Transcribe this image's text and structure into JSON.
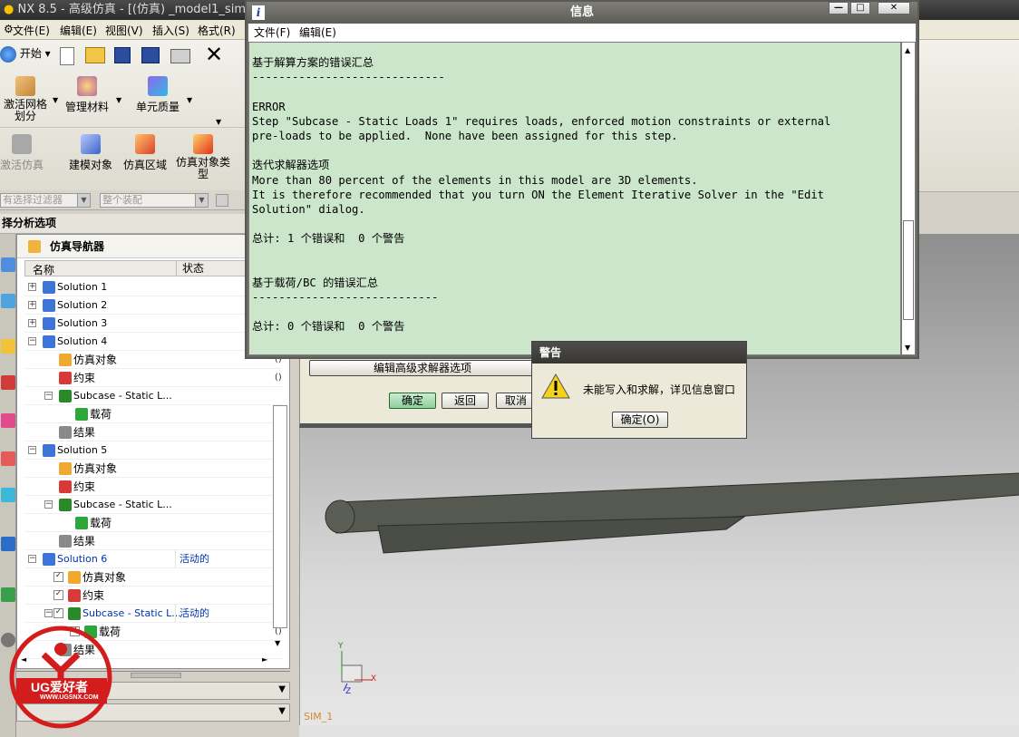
{
  "app": {
    "title": "NX 8.5 - 高级仿真 - [(仿真) _model1_sim5.s"
  },
  "main_menu": [
    "文件(E)",
    "编辑(E)",
    "视图(V)",
    "插入(S)",
    "格式(R)"
  ],
  "toolbar": {
    "start_label": "开始",
    "row2": [
      "激活网格划分",
      "管理材料",
      "单元质量"
    ],
    "row3": [
      "激活仿真",
      "建模对象",
      "仿真区域",
      "仿真对象类型"
    ]
  },
  "filter": {
    "selection_filter": "有选择过滤器",
    "assembly": "整个装配"
  },
  "left_panel": {
    "header": "择分析选项",
    "nav_title": "仿真导航器",
    "col_name": "名称",
    "col_status": "状态",
    "rows": [
      {
        "label": "Solution 1",
        "status": "",
        "tail": ""
      },
      {
        "label": "Solution 2",
        "status": "",
        "tail": ""
      },
      {
        "label": "Solution 3",
        "status": "",
        "tail": ""
      },
      {
        "label": "Solution 4",
        "status": "",
        "tail": ""
      },
      {
        "label": "仿真对象",
        "status": "",
        "tail": "()"
      },
      {
        "label": "约束",
        "status": "",
        "tail": "()"
      },
      {
        "label": "Subcase - Static L...",
        "status": "",
        "tail": ""
      },
      {
        "label": "载荷",
        "status": "",
        "tail": "()"
      },
      {
        "label": "结果",
        "status": "",
        "tail": ""
      },
      {
        "label": "Solution 5",
        "status": "",
        "tail": ""
      },
      {
        "label": "仿真对象",
        "status": "",
        "tail": "()"
      },
      {
        "label": "约束",
        "status": "",
        "tail": "()"
      },
      {
        "label": "Subcase - Static L...",
        "status": "",
        "tail": ""
      },
      {
        "label": "载荷",
        "status": "",
        "tail": "()"
      },
      {
        "label": "结果",
        "status": "",
        "tail": ""
      },
      {
        "label": "Solution 6",
        "status": "活动的",
        "tail": ""
      },
      {
        "label": "仿真对象",
        "status": "",
        "tail": "()"
      },
      {
        "label": "约束",
        "status": "",
        "tail": "()"
      },
      {
        "label": "Subcase - Static L...",
        "status": "活动的",
        "tail": ""
      },
      {
        "label": "载荷",
        "status": "",
        "tail": "()"
      },
      {
        "label": "结果",
        "status": "",
        "tail": ""
      }
    ]
  },
  "behind_dialog": {
    "edit_solver_label": "编辑高级求解器选项",
    "ok": "确定",
    "back": "返回",
    "cancel": "取消"
  },
  "info_window": {
    "title": "信息",
    "menu": [
      "文件(F)",
      "编辑(E)"
    ],
    "lines": [
      "基于解算方案的错误汇总",
      "-----------------------------",
      "",
      "ERROR",
      "Step \"Subcase - Static Loads 1\" requires loads, enforced motion constraints or external",
      "pre-loads to be applied.  None have been assigned for this step.",
      "",
      "迭代求解器选项",
      "More than 80 percent of the elements in this model are 3D elements.",
      "It is therefore recommended that you turn ON the Element Iterative Solver in the \"Edit",
      "Solution\" dialog.",
      "",
      "总计: 1 个错误和  0 个警告",
      "",
      "",
      "基于载荷/BC 的错误汇总",
      "----------------------------",
      "",
      "总计: 0 个错误和  0 个警告"
    ]
  },
  "warning_dialog": {
    "title": "警告",
    "message": "未能写入和求解，详见信息窗口",
    "ok": "确定(O)"
  },
  "viewport": {
    "sim_label": "SIM_1",
    "axis_x": "X",
    "axis_y": "Y",
    "axis_z": "Z"
  },
  "watermark": {
    "brand": "UG爱好者",
    "url": "WWW.UGSNX.COM"
  }
}
